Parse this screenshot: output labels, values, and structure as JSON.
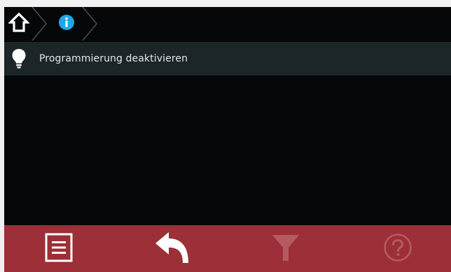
{
  "breadcrumb": {
    "items": [
      {
        "icon": "home-icon"
      },
      {
        "icon": "info-icon"
      }
    ]
  },
  "list": {
    "items": [
      {
        "icon": "lightbulb-icon",
        "label": "Programmierung deaktivieren"
      }
    ]
  },
  "bottom_bar": {
    "buttons": [
      {
        "icon": "menu-list-icon",
        "enabled": true
      },
      {
        "icon": "back-arrow-icon",
        "enabled": true
      },
      {
        "icon": "filter-icon",
        "enabled": false
      },
      {
        "icon": "help-icon",
        "enabled": false
      }
    ]
  },
  "colors": {
    "screen_background": "#050708",
    "row_background": "#1c2628",
    "bottom_bar": "#9c2f37",
    "info_accent": "#1ea7e8",
    "disabled_icon": "#b65a61"
  }
}
